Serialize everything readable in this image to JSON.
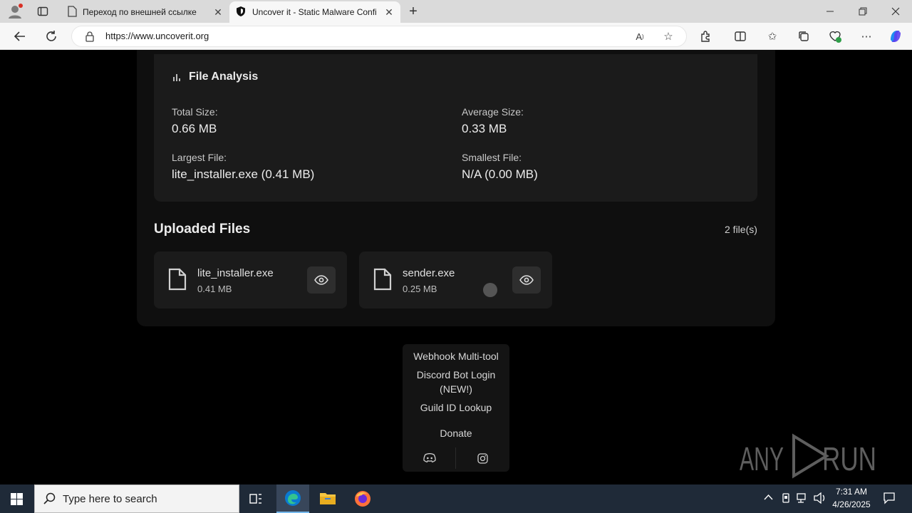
{
  "browser": {
    "tabs": [
      {
        "title": "Переход по внешней ссылке",
        "active": false
      },
      {
        "title": "Uncover it - Static Malware Confi",
        "active": true
      }
    ],
    "new_tab_label": "+",
    "url": "https://www.uncoverit.org"
  },
  "analysis": {
    "heading": "File Analysis",
    "total_size_label": "Total Size:",
    "total_size_value": "0.66 MB",
    "average_size_label": "Average Size:",
    "average_size_value": "0.33 MB",
    "largest_file_label": "Largest File:",
    "largest_file_value": "lite_installer.exe (0.41 MB)",
    "smallest_file_label": "Smallest File:",
    "smallest_file_value": "N/A (0.00 MB)"
  },
  "uploads": {
    "heading": "Uploaded Files",
    "count": "2 file(s)",
    "files": [
      {
        "name": "lite_installer.exe",
        "size": "0.41 MB"
      },
      {
        "name": "sender.exe",
        "size": "0.25 MB"
      }
    ]
  },
  "menu": {
    "items": [
      "Webhook Multi-tool",
      "Discord Bot Login",
      "(NEW!)",
      "Guild ID Lookup",
      "Donate"
    ]
  },
  "watermark": "ANY RUN",
  "taskbar": {
    "search_placeholder": "Type here to search",
    "time": "7:31 AM",
    "date": "4/26/2025"
  },
  "colors": {
    "page_bg": "#000000",
    "card_bg": "#1b1b1b",
    "taskbar_bg": "#1f2a38",
    "accent_edge": "#0b7ad1"
  }
}
